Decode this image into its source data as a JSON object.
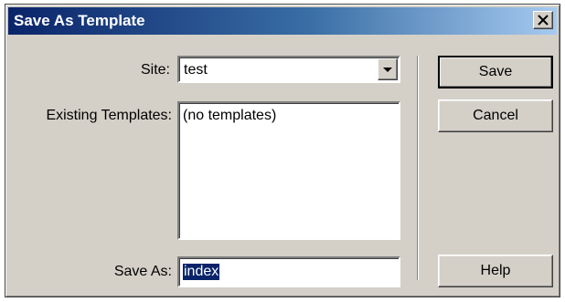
{
  "window": {
    "title": "Save As Template",
    "close_glyph": "✕",
    "close_icon": "close-icon"
  },
  "form": {
    "site_label": "Site:",
    "site_value": "test",
    "existing_label": "Existing Templates:",
    "existing_items": [
      "(no templates)"
    ],
    "save_as_label": "Save As:",
    "save_as_value": "index"
  },
  "buttons": {
    "save": "Save",
    "cancel": "Cancel",
    "help": "Help"
  },
  "colors": {
    "title_gradient_start": "#0a246a",
    "title_gradient_end": "#a6caf0",
    "dialog_face": "#d4d0c8",
    "selection": "#0a246a"
  }
}
